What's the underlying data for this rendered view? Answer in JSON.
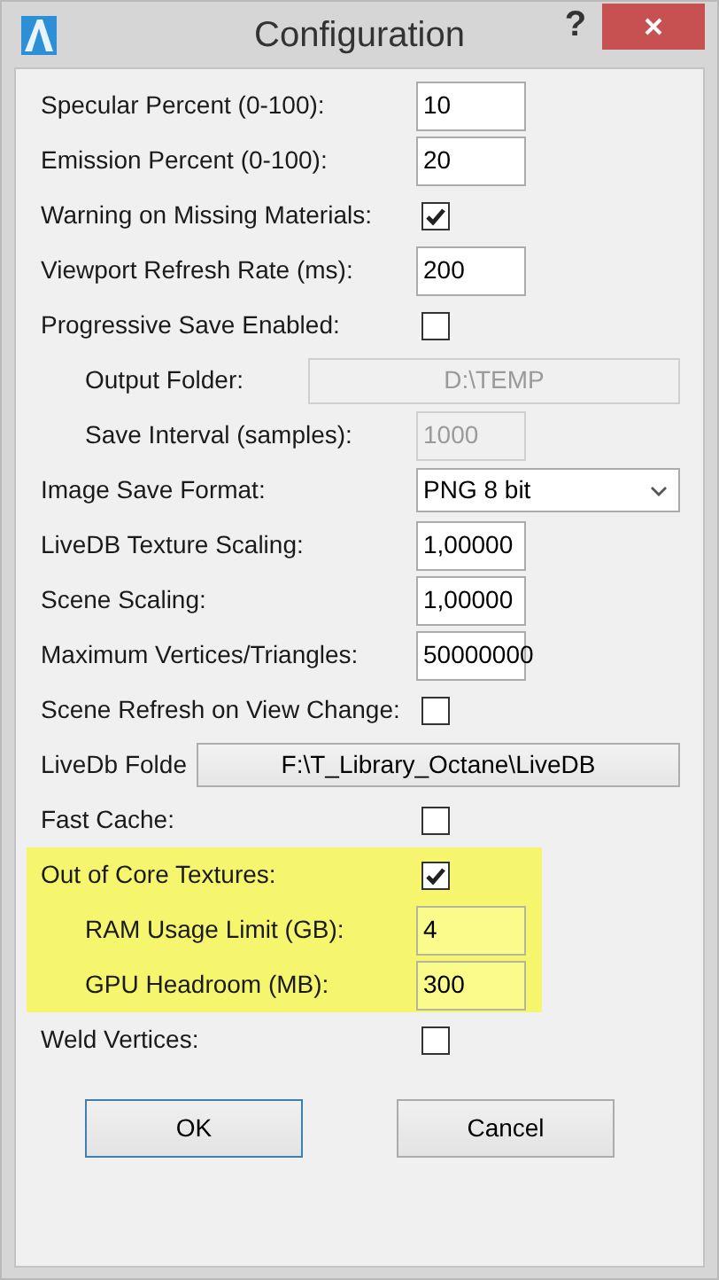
{
  "window": {
    "title": "Configuration",
    "help": "?"
  },
  "rows": [
    {
      "kind": "field",
      "label": "Specular Percent (0-100):",
      "value": "10",
      "indented": false,
      "disabled": false,
      "highlighted": false
    },
    {
      "kind": "field",
      "label": "Emission Percent (0-100):",
      "value": "20",
      "indented": false,
      "disabled": false,
      "highlighted": false
    },
    {
      "kind": "checkbox",
      "label": "Warning on Missing Materials:",
      "checked": true,
      "indented": false,
      "disabled": false,
      "highlighted": false
    },
    {
      "kind": "field",
      "label": "Viewport Refresh Rate (ms):",
      "value": "200",
      "indented": false,
      "disabled": false,
      "highlighted": false
    },
    {
      "kind": "checkbox",
      "label": "Progressive Save Enabled:",
      "checked": false,
      "indented": false,
      "disabled": false,
      "highlighted": false
    },
    {
      "kind": "folder",
      "label": "Output Folder:",
      "value": "D:\\TEMP",
      "indented": true,
      "disabled": true,
      "highlighted": false
    },
    {
      "kind": "field",
      "label": "Save Interval (samples):",
      "value": "1000",
      "indented": true,
      "disabled": true,
      "highlighted": false
    },
    {
      "kind": "combo",
      "label": "Image Save Format:",
      "value": "PNG 8 bit",
      "indented": false,
      "disabled": false,
      "highlighted": false
    },
    {
      "kind": "field",
      "label": "LiveDB Texture Scaling:",
      "value": "1,00000",
      "indented": false,
      "disabled": false,
      "highlighted": false
    },
    {
      "kind": "field",
      "label": "Scene Scaling:",
      "value": "1,00000",
      "indented": false,
      "disabled": false,
      "highlighted": false
    },
    {
      "kind": "field",
      "label": "Maximum Vertices/Triangles:",
      "value": "50000000",
      "indented": false,
      "disabled": false,
      "highlighted": false
    },
    {
      "kind": "checkbox",
      "label": "Scene Refresh on View Change:",
      "checked": false,
      "indented": false,
      "disabled": false,
      "highlighted": false
    },
    {
      "kind": "path",
      "label": "LiveDb Folde",
      "value": "F:\\T_Library_Octane\\LiveDB",
      "indented": false,
      "disabled": false,
      "highlighted": false
    },
    {
      "kind": "checkbox",
      "label": "Fast Cache:",
      "checked": false,
      "indented": false,
      "disabled": false,
      "highlighted": false
    },
    {
      "kind": "checkbox",
      "label": "Out of Core Textures:",
      "checked": true,
      "indented": false,
      "disabled": false,
      "highlighted": true
    },
    {
      "kind": "field",
      "label": "RAM Usage Limit (GB):",
      "value": "4",
      "indented": true,
      "disabled": false,
      "highlighted": true
    },
    {
      "kind": "field",
      "label": "GPU Headroom (MB):",
      "value": "300",
      "indented": true,
      "disabled": false,
      "highlighted": true
    },
    {
      "kind": "checkbox",
      "label": "Weld Vertices:",
      "checked": false,
      "indented": false,
      "disabled": false,
      "highlighted": false
    }
  ],
  "buttons": [
    {
      "label": "OK",
      "default": true
    },
    {
      "label": "Cancel",
      "default": false
    }
  ]
}
